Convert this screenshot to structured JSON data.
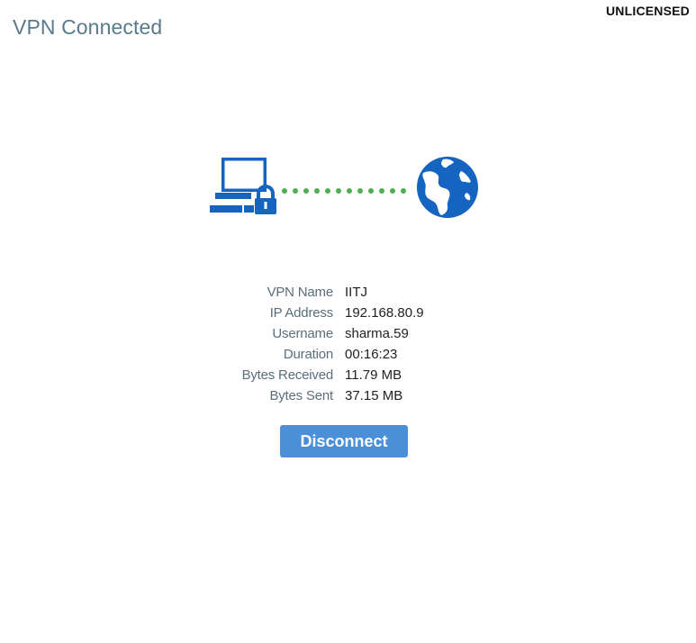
{
  "header": {
    "title": "VPN Connected",
    "license_status": "UNLICENSED"
  },
  "connection_graphic": {
    "icons": [
      "laptop-icon",
      "lock-icon",
      "globe-icon"
    ],
    "link_color": "#4caf50",
    "icon_color": "#1565c0"
  },
  "details": [
    {
      "label": "VPN Name",
      "value": "IITJ"
    },
    {
      "label": "IP Address",
      "value": "192.168.80.9"
    },
    {
      "label": "Username",
      "value": "sharma.59"
    },
    {
      "label": "Duration",
      "value": "00:16:23"
    },
    {
      "label": "Bytes Received",
      "value": "11.79 MB"
    },
    {
      "label": "Bytes Sent",
      "value": "37.15 MB"
    }
  ],
  "actions": {
    "disconnect_label": "Disconnect"
  }
}
